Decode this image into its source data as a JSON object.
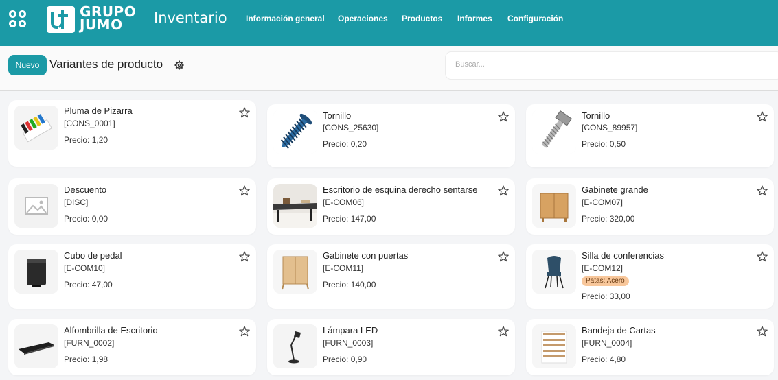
{
  "header": {
    "logo_line1": "GRUPO",
    "logo_line2": "JUMO",
    "app_title": "Inventario",
    "menu": [
      "Información general",
      "Operaciones",
      "Productos",
      "Informes",
      "Configuración"
    ]
  },
  "control": {
    "new_label": "Nuevo",
    "page_title": "Variantes de producto",
    "search_placeholder": "Buscar..."
  },
  "price_prefix": "Precio: ",
  "products": [
    {
      "name": "Pluma de Pizarra",
      "ref": "[CONS_0001]",
      "price": "1,20",
      "image": "markers",
      "badge": ""
    },
    {
      "name": "Tornillo",
      "ref": "[CONS_25630]",
      "price": "0,20",
      "image": "screw-blue",
      "badge": ""
    },
    {
      "name": "Tornillo",
      "ref": "[CONS_89957]",
      "price": "0,50",
      "image": "bolt-silver",
      "badge": ""
    },
    {
      "name": "Descuento",
      "ref": "[DISC]",
      "price": "0,00",
      "image": "placeholder",
      "badge": ""
    },
    {
      "name": "Escritorio de esquina derecho sentarse",
      "ref": "[E-COM06]",
      "price": "147,00",
      "image": "desk",
      "badge": ""
    },
    {
      "name": "Gabinete grande",
      "ref": "[E-COM07]",
      "price": "320,00",
      "image": "cabinet-large",
      "badge": ""
    },
    {
      "name": "Cubo de pedal",
      "ref": "[E-COM10]",
      "price": "47,00",
      "image": "pedal-bin",
      "badge": ""
    },
    {
      "name": "Gabinete con puertas",
      "ref": "[E-COM11]",
      "price": "140,00",
      "image": "cabinet-doors",
      "badge": ""
    },
    {
      "name": "Silla de conferencias",
      "ref": "[E-COM12]",
      "price": "33,00",
      "image": "chair",
      "badge": "Patas: Acero"
    },
    {
      "name": "Alfombrilla de Escritorio",
      "ref": "[FURN_0002]",
      "price": "1,98",
      "image": "desk-pad",
      "badge": ""
    },
    {
      "name": "Lámpara LED",
      "ref": "[FURN_0003]",
      "price": "0,90",
      "image": "lamp",
      "badge": ""
    },
    {
      "name": "Bandeja de Cartas",
      "ref": "[FURN_0004]",
      "price": "4,80",
      "image": "letter-tray",
      "badge": ""
    }
  ],
  "colors": {
    "brand": "#1b9aa6",
    "badge_bg": "#f8c79b"
  }
}
